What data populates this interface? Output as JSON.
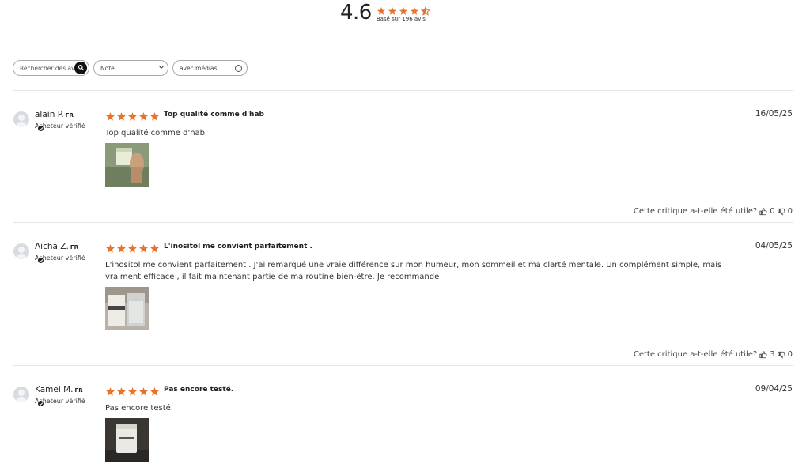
{
  "summary": {
    "average": "4.6",
    "rating_value": 4.6,
    "based_on": "Basé sur 196 avis"
  },
  "filters": {
    "search_placeholder": "Rechercher des avis",
    "note_label": "Note",
    "media_label": "avec médias"
  },
  "colors": {
    "star": "#E8732A",
    "star_empty": "#E8732A"
  },
  "reviews": [
    {
      "name": "alain P.",
      "country": "FR",
      "verified": "Acheteur vérifié",
      "rating": 5,
      "title": "Top qualité comme d'hab",
      "body": "Top qualité comme d'hab",
      "date": "16/05/25",
      "helpful_question": "Cette critique a-t-elle été utile?",
      "likes": "0",
      "dislikes": "0"
    },
    {
      "name": "Aicha Z.",
      "country": "FR",
      "verified": "Acheteur vérifié",
      "rating": 5,
      "title": "L'inositol me convient parfaitement .",
      "body": "L'inositol me convient parfaitement . J'ai remarqué une vraie différence sur mon humeur, mon sommeil et ma clarté mentale. Un complément simple, mais vraiment efficace , il fait maintenant partie de ma routine bien-être. Je recommande",
      "date": "04/05/25",
      "helpful_question": "Cette critique a-t-elle été utile?",
      "likes": "3",
      "dislikes": "0"
    },
    {
      "name": "Kamel M.",
      "country": "FR",
      "verified": "Acheteur vérifié",
      "rating": 5,
      "title": "Pas encore testé.",
      "body": "Pas encore testé.",
      "date": "09/04/25",
      "helpful_question": "",
      "likes": "",
      "dislikes": ""
    }
  ]
}
